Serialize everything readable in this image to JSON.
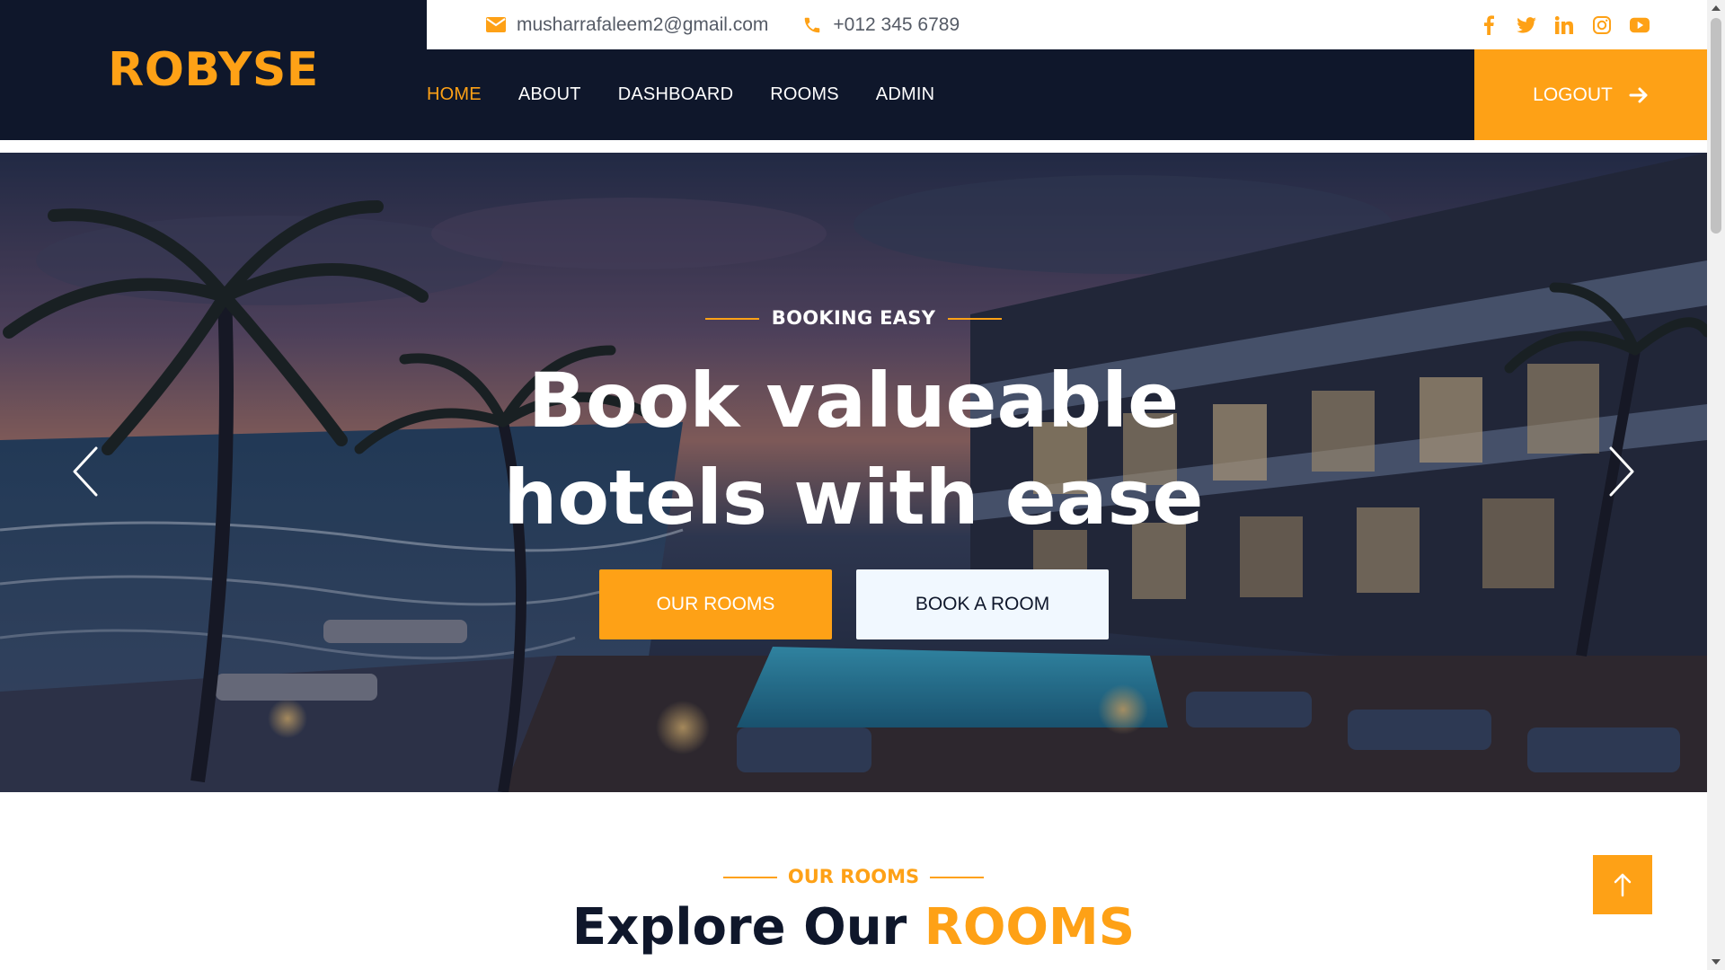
{
  "brand": {
    "name": "ROBYSE"
  },
  "topbar": {
    "email": "musharrafaleem2@gmail.com",
    "phone": "+012 345 6789",
    "socials": [
      "facebook-icon",
      "twitter-icon",
      "linkedin-icon",
      "instagram-icon",
      "youtube-icon"
    ]
  },
  "nav": {
    "items": [
      {
        "label": "HOME",
        "active": true
      },
      {
        "label": "ABOUT",
        "active": false
      },
      {
        "label": "DASHBOARD",
        "active": false
      },
      {
        "label": "ROOMS",
        "active": false
      },
      {
        "label": "ADMIN",
        "active": false
      }
    ],
    "logout": "LOGOUT"
  },
  "hero": {
    "eyebrow": "BOOKING EASY",
    "title_line1": "Book valueable",
    "title_line2": "hotels with ease",
    "primary_button": "OUR ROOMS",
    "secondary_button": "BOOK A ROOM"
  },
  "rooms": {
    "eyebrow": "OUR ROOMS",
    "title_part1": "Explore Our",
    "title_accent": "ROOMS"
  },
  "colors": {
    "primary": "#fea116",
    "dark": "#0f172b",
    "light": "#f1f8ff"
  }
}
